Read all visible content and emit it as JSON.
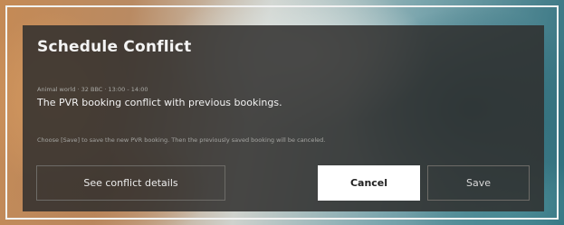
{
  "dialog": {
    "title": "Schedule Conflict",
    "program_info": "Animal world · 32 BBC · 13:00 - 14:00",
    "message": "The PVR booking conflict with previous bookings.",
    "note": "Choose [Save] to save the new PVR booking. Then the previously saved booking will be canceled.",
    "buttons": {
      "details_label": "See conflict details",
      "cancel_label": "Cancel",
      "save_label": "Save"
    }
  }
}
